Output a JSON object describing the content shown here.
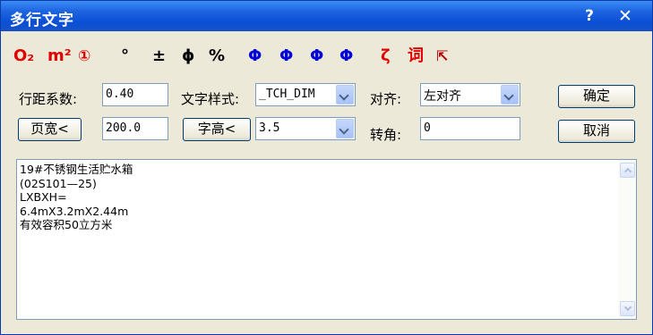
{
  "window": {
    "title": "多行文字",
    "help_label": "?",
    "close_label": "✕"
  },
  "toolbar": {
    "o2": "O₂",
    "m2": "m²",
    "circled1": "①",
    "degree": "°",
    "plusminus": "±",
    "phi": "ϕ",
    "percent": "%",
    "steel1": "Φ",
    "steel2": "Φ",
    "steel3": "Φ",
    "steel4": "Φ",
    "special": "ζ",
    "word": "词",
    "pick": "⇱"
  },
  "form": {
    "line_spacing_label": "行距系数:",
    "line_spacing_value": "0.40",
    "text_style_label": "文字样式:",
    "text_style_value": "_TCH_DIM",
    "align_label": "对齐:",
    "align_value": "左对齐",
    "ok_label": "确定",
    "page_width_button": "页宽<",
    "page_width_value": "200.0",
    "char_height_button": "字高<",
    "char_height_value": "3.5",
    "rotation_label": "转角:",
    "rotation_value": "0",
    "cancel_label": "取消"
  },
  "text": {
    "lines": [
      "19#不锈钢生活贮水箱",
      "(02S101—25)",
      "LXBXH=",
      "6.4mX3.2mX2.44m",
      "有效容积50立方米"
    ]
  }
}
